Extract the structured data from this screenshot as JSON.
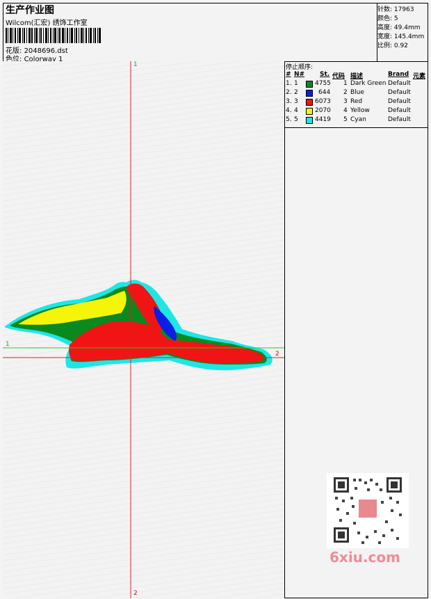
{
  "header": {
    "title": "生产作业图",
    "subtitle": "Wilcom(汇宏) 绣饰工作室",
    "design_label": "花版:",
    "design_value": "2048696.dst",
    "colorway_label": "色位:",
    "colorway_value": "Colorway 1"
  },
  "stats": [
    {
      "label": "针数:",
      "value": "17963"
    },
    {
      "label": "颜色:",
      "value": "5"
    },
    {
      "label": "高度:",
      "value": "49.4mm"
    },
    {
      "label": "宽度:",
      "value": "145.4mm"
    },
    {
      "label": "比例:",
      "value": "0.92"
    }
  ],
  "stop_sequence": {
    "title": "停止顺序:",
    "columns": [
      "#",
      "N#",
      "St.",
      "代码",
      "描述",
      "Brand",
      "元素"
    ],
    "rows": [
      {
        "idx": "1.",
        "n": "1",
        "color": "#0a8a1e",
        "st": "4755",
        "code": "1",
        "desc": "Dark Green",
        "brand": "Default"
      },
      {
        "idx": "2.",
        "n": "2",
        "color": "#0a1ee6",
        "st": "644",
        "code": "2",
        "desc": "Blue",
        "brand": "Default"
      },
      {
        "idx": "3.",
        "n": "3",
        "color": "#f01414",
        "st": "6073",
        "code": "3",
        "desc": "Red",
        "brand": "Default"
      },
      {
        "idx": "4.",
        "n": "4",
        "color": "#f5f50a",
        "st": "2070",
        "code": "4",
        "desc": "Yellow",
        "brand": "Default"
      },
      {
        "idx": "5.",
        "n": "5",
        "color": "#1ee6e6",
        "st": "4419",
        "code": "5",
        "desc": "Cyan",
        "brand": "Default"
      }
    ]
  },
  "axes": {
    "v_top": "1",
    "v_bottom": "2",
    "h_left": "1",
    "h_right": "2"
  },
  "watermark": {
    "text": "6xiu.com"
  }
}
